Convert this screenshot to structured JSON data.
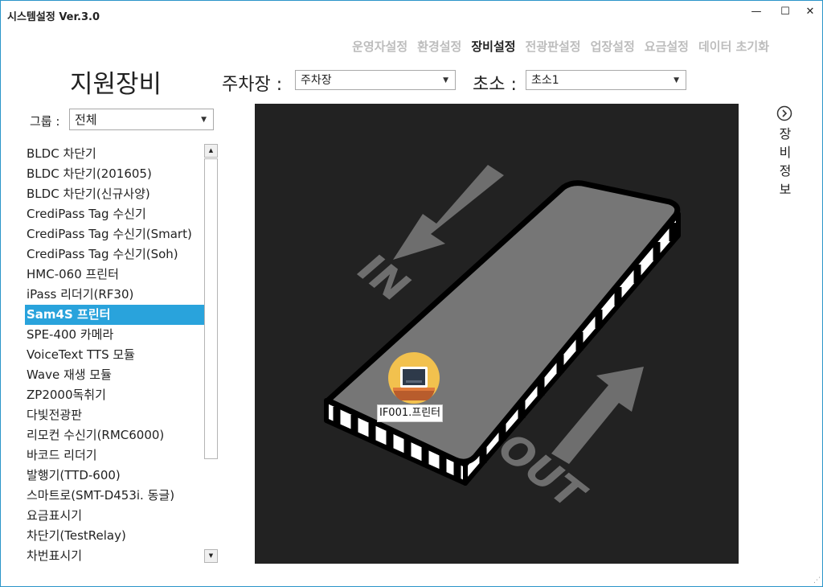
{
  "window": {
    "title": "시스템설정 Ver.3.0",
    "minimize_glyph": "—",
    "maximize_glyph": "☐",
    "close_glyph": "✕"
  },
  "menu": {
    "items": [
      "운영자설정",
      "환경설정",
      "장비설정",
      "전광판설정",
      "업장설정",
      "요금설정",
      "데이터 초기화"
    ],
    "active": "장비설정"
  },
  "page": {
    "heading": "지원장비",
    "parking_label": "주차장 :",
    "parking_value": "주차장",
    "booth_label": "초소 :",
    "booth_value": "초소1",
    "group_label": "그룹 :",
    "group_value": "전체"
  },
  "device_list": {
    "items": [
      "BLDC 차단기",
      "BLDC 차단기(201605)",
      "BLDC 차단기(신규사양)",
      "CrediPass Tag 수신기",
      "CrediPass Tag 수신기(Smart)",
      "CrediPass Tag 수신기(Soh)",
      "HMC-060 프린터",
      "iPass 리더기(RF30)",
      "Sam4S 프린터",
      "SPE-400 카메라",
      "VoiceText TTS 모듈",
      "Wave 재생 모듈",
      "ZP2000독취기",
      "다빛전광판",
      "리모컨 수신기(RMC6000)",
      "바코드 리더기",
      "발행기(TTD-600)",
      "스마트로(SMT-D453i. 동글)",
      "요금표시기",
      "차단기(TestRelay)",
      "차번표시기"
    ],
    "selected": "Sam4S 프린터"
  },
  "canvas": {
    "in_label": "IN",
    "out_label": "OUT",
    "device_label": "IF001.프린터",
    "device_icon": "printer-icon"
  },
  "side_panel": {
    "icon": "chevron-right-circle-icon",
    "chars": [
      "장",
      "비",
      "정",
      "보"
    ]
  },
  "colors": {
    "accent": "#29a3dc",
    "canvas_bg": "#222222",
    "lane_fill": "#767676",
    "arrow": "#6e6e6e"
  }
}
